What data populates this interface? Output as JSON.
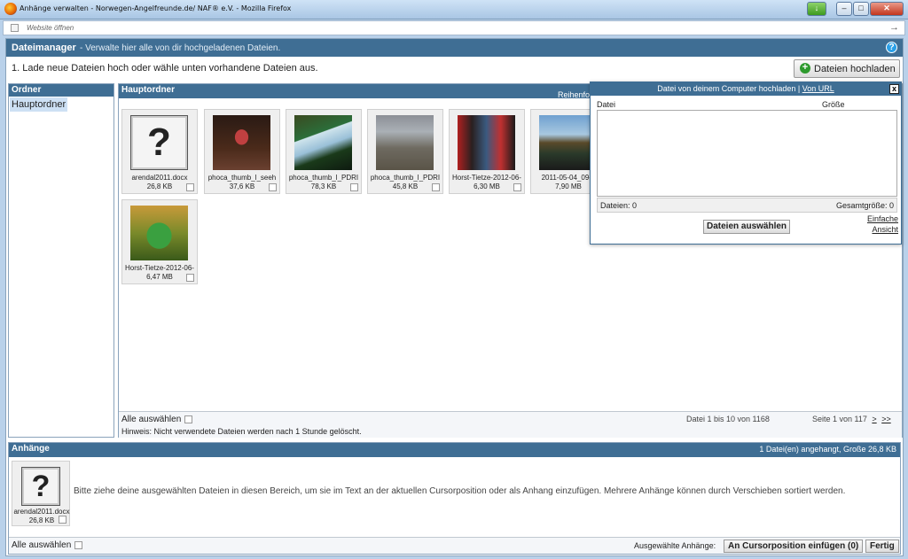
{
  "window": {
    "title": "Anhänge verwalten - Norwegen-Angelfreunde.de/ NAF® e.V. - Mozilla Firefox",
    "address_text": "Website öffnen"
  },
  "header": {
    "title": "Dateimanager",
    "subtitle": "- Verwalte hier alle von dir hochgeladenen Dateien."
  },
  "instruction": "1. Lade neue Dateien hoch oder wähle unten vorhandene Dateien aus.",
  "upload_button": "Dateien hochladen",
  "folders": {
    "heading": "Ordner",
    "items": [
      "Hauptordner"
    ]
  },
  "main": {
    "heading": "Hauptordner",
    "sort_label": "Reihenfo",
    "files": [
      {
        "name": "arendal2011.docx",
        "size": "26,8 KB",
        "type": "document"
      },
      {
        "name": "phoca_thumb_l_seeh",
        "size": "37,6 KB",
        "type": "photo"
      },
      {
        "name": "phoca_thumb_l_PDRI",
        "size": "78,3 KB",
        "type": "photo"
      },
      {
        "name": "phoca_thumb_l_PDRI",
        "size": "45,8 KB",
        "type": "photo"
      },
      {
        "name": "Horst-Tietze-2012-06-",
        "size": "6,30 MB",
        "type": "photo"
      },
      {
        "name": "2011-05-04_09-1",
        "size": "7,90 MB",
        "type": "photo"
      },
      {
        "name": "Horst-Tietze-2012-06-",
        "size": "6,47 MB",
        "type": "photo"
      }
    ],
    "select_all": "Alle auswählen",
    "hint": "Hinweis: Nicht verwendete Dateien werden nach 1 Stunde gelöscht.",
    "count": "Datei 1 bis 10 von 1168",
    "page": "Seite 1 von 117",
    "next": ">",
    "last": ">>"
  },
  "upload_popup": {
    "title": "Datei von deinem Computer hochladen |",
    "url_link": "Von URL",
    "close": "x",
    "col_file": "Datei",
    "col_size": "Größe",
    "files_count": "Dateien: 0",
    "total_size": "Gesamtgröße: 0",
    "choose_button": "Dateien auswählen",
    "simple_view_1": "Einfache",
    "simple_view_2": "Ansicht"
  },
  "attachments": {
    "heading": "Anhänge",
    "info": "1 Datei(en) angehangt, Große 26,8 KB",
    "file": {
      "name": "arendal2011.docx",
      "size": "26,8 KB"
    },
    "help_text": "Bitte ziehe deine ausgewählten Dateien in diesen Bereich, um sie im Text an der aktuellen Cursorposition oder als Anhang einzufügen. Mehrere Anhänge können durch Verschieben sortiert werden.",
    "select_all": "Alle auswählen",
    "selected_label": "Ausgewählte Anhänge:",
    "insert_button": "An Cursorposition einfügen (0)",
    "done_button": "Fertig"
  },
  "colors": {
    "header_bar": "#3f6e94",
    "selection": "#cde0f4",
    "upload_icon": "#2d9a2d"
  }
}
